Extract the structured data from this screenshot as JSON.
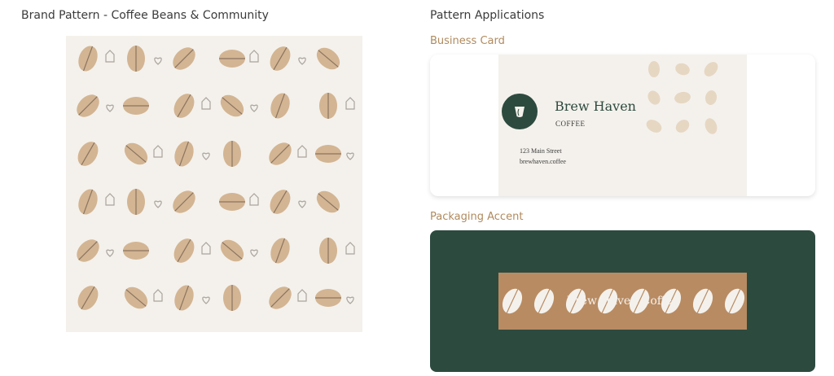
{
  "pattern_section": {
    "title": "Brand Pattern - Coffee Beans & Community",
    "colors": {
      "background": "#f4f1ec",
      "bean": "#d3b593",
      "bean_crease": "#8a7460",
      "outline_icon": "#a9a49c"
    }
  },
  "applications": {
    "title": "Pattern Applications",
    "business_card": {
      "label": "Business Card",
      "brand_name": "Brew Haven",
      "brand_sub": "COFFEE",
      "address": "123 Main Street",
      "website": "brewhaven.coffee",
      "colors": {
        "logo": "#2d4a3f",
        "card_bg": "#f4f1ec",
        "bean_faded": "#e6d7c3"
      }
    },
    "packaging": {
      "label": "Packaging Accent",
      "band_text": "Brew Haven Coffee",
      "colors": {
        "background": "#2d4a3f",
        "band": "#b88b62",
        "bean": "#f4f1ec"
      }
    }
  }
}
